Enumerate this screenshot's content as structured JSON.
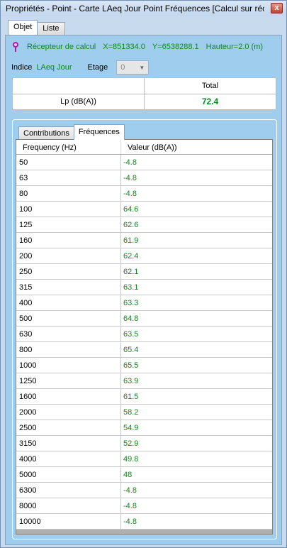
{
  "window": {
    "title": "Propriétés - Point - Carte LAeq Jour Point Fréquences [Calcul sur réc...",
    "close_glyph": "x"
  },
  "outer_tabs": [
    {
      "label": "Objet",
      "active": true
    },
    {
      "label": "Liste",
      "active": false
    }
  ],
  "receiver": {
    "name": "Récepteur de calcul",
    "x": "X=851334.0",
    "y": "Y=6538288.1",
    "height": "Hauteur=2.0 (m)"
  },
  "indice": {
    "label": "Indice",
    "value": "LAeq Jour",
    "etage_label": "Etage",
    "etage_value": "0"
  },
  "total_table": {
    "header": "Total",
    "row_label": "Lp (dB(A))",
    "row_value": "72.4"
  },
  "inner_tabs": [
    {
      "label": "Contributions",
      "active": false
    },
    {
      "label": "Fréquences",
      "active": true
    }
  ],
  "grid": {
    "columns": [
      "Frequency (Hz)",
      "Valeur (dB(A))"
    ],
    "rows": [
      {
        "freq": "50",
        "value": "-4.8"
      },
      {
        "freq": "63",
        "value": "-4.8"
      },
      {
        "freq": "80",
        "value": "-4.8"
      },
      {
        "freq": "100",
        "value": "64.6"
      },
      {
        "freq": "125",
        "value": "62.6"
      },
      {
        "freq": "160",
        "value": "61.9"
      },
      {
        "freq": "200",
        "value": "62.4"
      },
      {
        "freq": "250",
        "value": "62.1"
      },
      {
        "freq": "315",
        "value": "63.1"
      },
      {
        "freq": "400",
        "value": "63.3"
      },
      {
        "freq": "500",
        "value": "64.8"
      },
      {
        "freq": "630",
        "value": "63.5"
      },
      {
        "freq": "800",
        "value": "65.4"
      },
      {
        "freq": "1000",
        "value": "65.5"
      },
      {
        "freq": "1250",
        "value": "63.9"
      },
      {
        "freq": "1600",
        "value": "61.5"
      },
      {
        "freq": "2000",
        "value": "58.2"
      },
      {
        "freq": "2500",
        "value": "54.9"
      },
      {
        "freq": "3150",
        "value": "52.9"
      },
      {
        "freq": "4000",
        "value": "49.8"
      },
      {
        "freq": "5000",
        "value": "48"
      },
      {
        "freq": "6300",
        "value": "-4.8"
      },
      {
        "freq": "8000",
        "value": "-4.8"
      },
      {
        "freq": "10000",
        "value": "-4.8"
      }
    ]
  },
  "colors": {
    "value_green": "#0e8a1a",
    "panel_blue": "#9fcdee"
  }
}
